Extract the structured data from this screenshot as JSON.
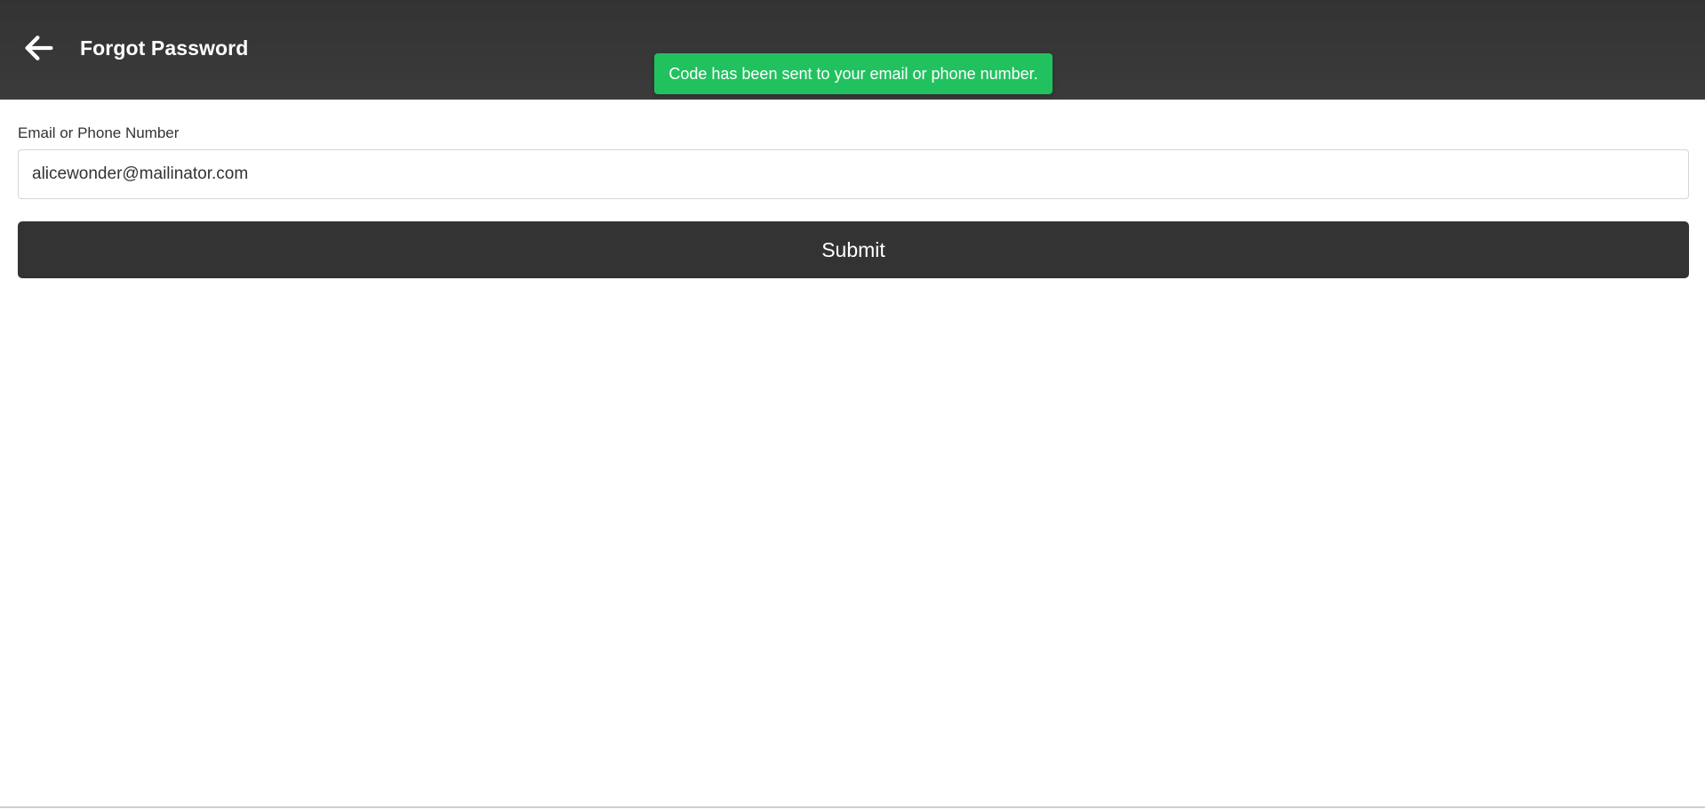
{
  "header": {
    "back_icon": "arrow-left-icon",
    "title": "Forgot Password"
  },
  "toast": {
    "message": "Code has been sent to your email or phone number.",
    "color": "#22c160"
  },
  "form": {
    "email_label": "Email or Phone Number",
    "email_value": "alicewonder@mailinator.com",
    "submit_label": "Submit"
  },
  "colors": {
    "header_bg": "#333333",
    "button_bg": "#333333",
    "text_light": "#ffffff"
  }
}
